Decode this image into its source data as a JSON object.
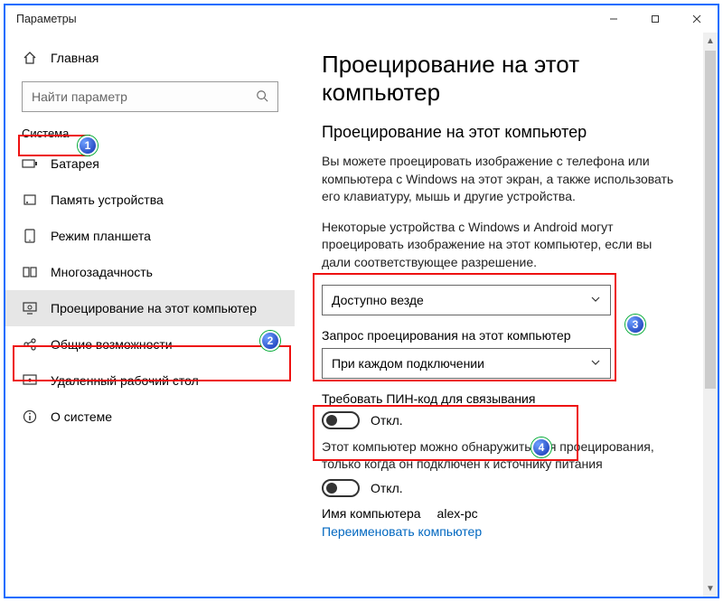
{
  "window": {
    "title": "Параметры"
  },
  "sidebar": {
    "home": "Главная",
    "search_placeholder": "Найти параметр",
    "section": "Система",
    "items": [
      {
        "label": "Батарея"
      },
      {
        "label": "Память устройства"
      },
      {
        "label": "Режим планшета"
      },
      {
        "label": "Многозадачность"
      },
      {
        "label": "Проецирование на этот компьютер"
      },
      {
        "label": "Общие возможности"
      },
      {
        "label": "Удаленный рабочий стол"
      },
      {
        "label": "О системе"
      }
    ]
  },
  "main": {
    "h1": "Проецирование на этот компьютер",
    "h2": "Проецирование на этот компьютер",
    "para1": "Вы можете проецировать изображение с телефона или компьютера с Windows на этот экран, а также использовать его клавиатуру, мышь и другие устройства.",
    "para2": "Некоторые устройства с Windows и Android могут проецировать изображение на этот компьютер, если вы дали соответствующее разрешение.",
    "dropdown1_value": "Доступно везде",
    "request_label": "Запрос проецирования на этот компьютер",
    "dropdown2_value": "При каждом подключении",
    "pin_label": "Требовать ПИН-код для связывания",
    "toggle_off": "Откл.",
    "power_para": "Этот компьютер можно обнаружить для проецирования, только когда он подключен к источнику питания",
    "pcname_label": "Имя компьютера",
    "pcname_value": "alex-pc",
    "rename_link": "Переименовать компьютер"
  },
  "annotations": {
    "n1": "1",
    "n2": "2",
    "n3": "3",
    "n4": "4"
  }
}
